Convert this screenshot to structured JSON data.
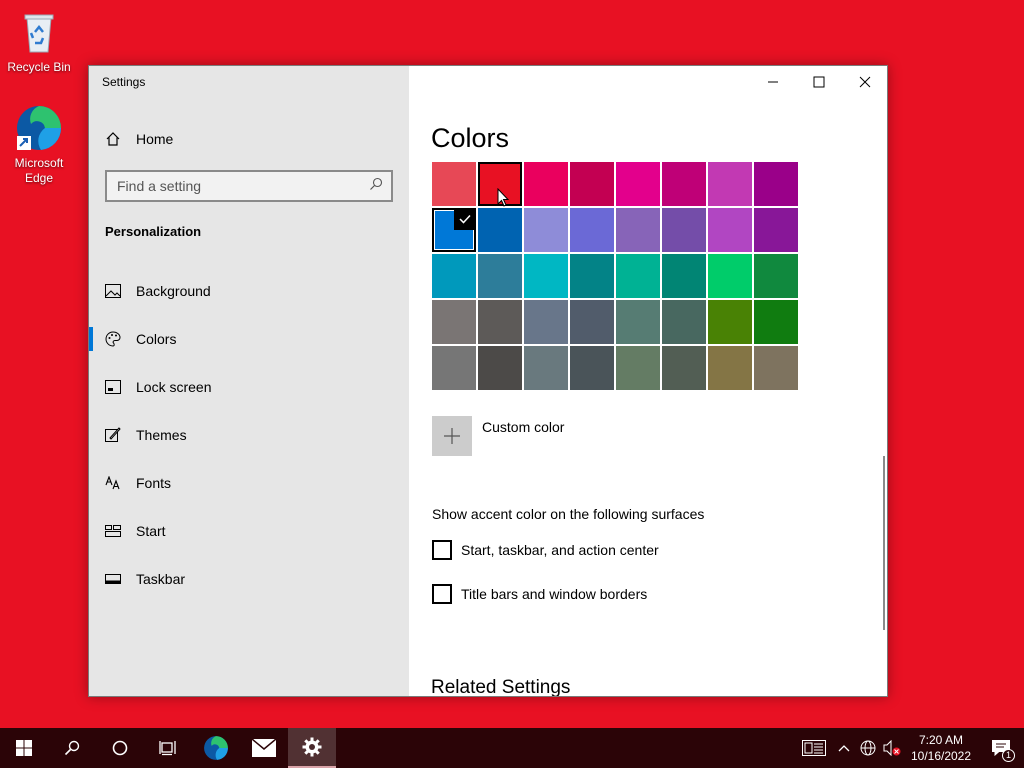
{
  "desktop": {
    "icons": [
      {
        "label": "Recycle Bin",
        "icon": "recycle-bin-icon"
      },
      {
        "label": "Microsoft Edge",
        "icon": "edge-icon"
      }
    ],
    "wallpaper_color": "#e81123"
  },
  "window": {
    "title": "Settings",
    "controls": {
      "minimize": "minimize-icon",
      "maximize": "maximize-icon",
      "close": "close-icon"
    }
  },
  "sidebar": {
    "home_label": "Home",
    "search_placeholder": "Find a setting",
    "section_title": "Personalization",
    "items": [
      {
        "label": "Background",
        "icon": "picture-icon"
      },
      {
        "label": "Colors",
        "icon": "palette-icon",
        "active": true
      },
      {
        "label": "Lock screen",
        "icon": "lock-screen-icon"
      },
      {
        "label": "Themes",
        "icon": "themes-icon"
      },
      {
        "label": "Fonts",
        "icon": "fonts-icon"
      },
      {
        "label": "Start",
        "icon": "start-icon"
      },
      {
        "label": "Taskbar",
        "icon": "taskbar-icon"
      }
    ]
  },
  "content": {
    "page_title": "Colors",
    "swatches": [
      "#e74856",
      "#e81123",
      "#ea005e",
      "#c30052",
      "#e3008c",
      "#bf0077",
      "#c239b3",
      "#9a0089",
      "#0078d7",
      "#0063b1",
      "#8e8cd8",
      "#6b69d6",
      "#8764b8",
      "#744da9",
      "#b146c2",
      "#881798",
      "#0099bc",
      "#2d7d9a",
      "#00b7c3",
      "#038387",
      "#00b294",
      "#018574",
      "#00cc6a",
      "#10893e",
      "#7a7574",
      "#5d5a58",
      "#68768a",
      "#515c6b",
      "#567c73",
      "#486860",
      "#498205",
      "#107c10",
      "#767676",
      "#4c4a48",
      "#69797e",
      "#4a5459",
      "#647c64",
      "#525e54",
      "#847545",
      "#7e735f"
    ],
    "checked_swatch_index": 8,
    "hovered_swatch_index": 1,
    "custom_color_label": "Custom color",
    "surfaces_heading": "Show accent color on the following surfaces",
    "checkboxes": [
      {
        "label": "Start, taskbar, and action center",
        "checked": false
      },
      {
        "label": "Title bars and window borders",
        "checked": false
      }
    ],
    "related_settings_heading": "Related Settings"
  },
  "taskbar": {
    "buttons": [
      "start-icon",
      "search-icon",
      "cortana-icon",
      "task-view-icon",
      "edge-icon",
      "mail-icon",
      "settings-icon"
    ],
    "tray_icons": [
      "news-icon",
      "chevron-up-icon",
      "network-icon",
      "volume-muted-icon"
    ],
    "time": "7:20 AM",
    "date": "10/16/2022",
    "notification_count": "1"
  }
}
